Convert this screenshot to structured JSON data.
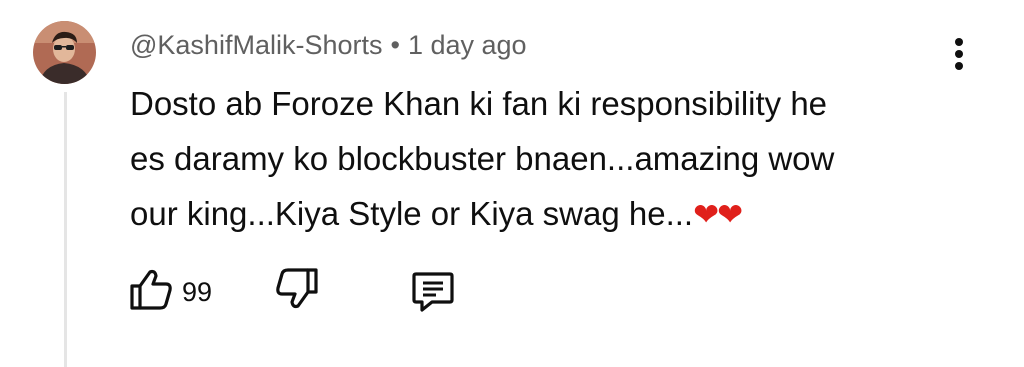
{
  "comment": {
    "author": "@KashifMalik-Shorts",
    "separator": "•",
    "time": "1 day ago",
    "lines": [
      "Dosto ab Foroze Khan ki fan ki responsibility he",
      "es daramy ko blockbuster bnaen...amazing wow",
      "our king...Kiya Style or Kiya swag he..."
    ],
    "emoji": "❤❤"
  },
  "actions": {
    "like_count": "99",
    "icons": [
      "thumbs-up-icon",
      "thumbs-down-icon",
      "reply-icon",
      "more-vertical-icon"
    ]
  },
  "colors": {
    "meta": "#606060",
    "text": "#0f0f0f",
    "heart": "#e0201b",
    "thread": "#e5e5e5"
  }
}
